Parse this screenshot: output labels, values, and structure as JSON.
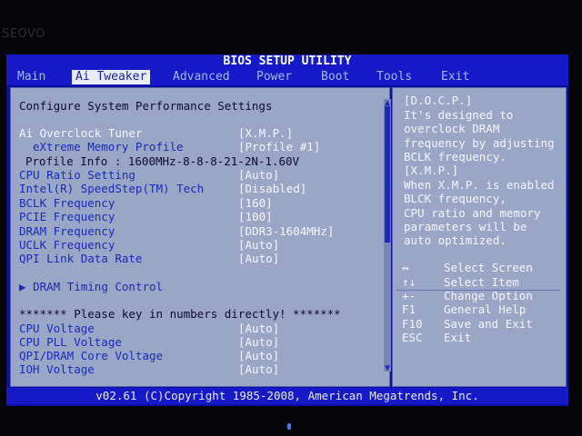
{
  "brand": "SEOVO",
  "title": "BIOS SETUP UTILITY",
  "tabs": [
    "Main",
    "Ai Tweaker",
    "Advanced",
    "Power",
    "Boot",
    "Tools",
    "Exit"
  ],
  "active_tab": "Ai Tweaker",
  "section_title": "Configure System Performance Settings",
  "settings": [
    {
      "label": "Ai Overclock Tuner",
      "value": "[X.M.P.]"
    },
    {
      "label": "eXtreme Memory Profile",
      "value": "[Profile #1]"
    },
    {
      "label": "Profile Info : 1600MHz-8-8-8-21-2N-1.60V"
    },
    {
      "label": "CPU Ratio Setting",
      "value": "[Auto]"
    },
    {
      "label": "Intel(R) SpeedStep(TM) Tech",
      "value": "[Disabled]"
    },
    {
      "label": "BCLK Frequency",
      "value": "[160]"
    },
    {
      "label": "PCIE Frequency",
      "value": "[100]"
    },
    {
      "label": "DRAM Frequency",
      "value": "[DDR3-1604MHz]"
    },
    {
      "label": "UCLK Frequency",
      "value": "[Auto]"
    },
    {
      "label": "QPI Link Data Rate",
      "value": "[Auto]"
    },
    {
      "label": "DRAM Timing Control",
      "prefix": "▶"
    },
    {
      "label": "******* Please key in numbers directly! *******"
    },
    {
      "label": "CPU Voltage",
      "value": "[Auto]"
    },
    {
      "label": "CPU PLL Voltage",
      "value": "[Auto]"
    },
    {
      "label": "QPI/DRAM Core Voltage",
      "value": "[Auto]"
    },
    {
      "label": "IOH Voltage",
      "value": "[Auto]"
    }
  ],
  "help_text": [
    "[D.O.C.P.]",
    "It's designed to",
    "overclock DRAM",
    "frequency by adjusting",
    "BCLK frequency.",
    "[X.M.P.]",
    "When X.M.P. is enabled",
    "BLCK frequency,",
    "CPU ratio and memory",
    "parameters will be",
    "auto optimized."
  ],
  "keys": [
    {
      "key": "↔",
      "desc": "Select Screen"
    },
    {
      "key": "↑↓",
      "desc": "Select Item"
    },
    {
      "key": "+-",
      "desc": "Change Option"
    },
    {
      "key": "F1",
      "desc": "General Help"
    },
    {
      "key": "F10",
      "desc": "Save and Exit"
    },
    {
      "key": "ESC",
      "desc": "Exit"
    }
  ],
  "footer": "v02.61 (C)Copyright 1985-2008, American Megatrends, Inc.",
  "colors": {
    "screen": "#0b0fa8",
    "panel": "#9aa6c6",
    "label": "#1c2ab8",
    "value": "#f4f6ff"
  }
}
